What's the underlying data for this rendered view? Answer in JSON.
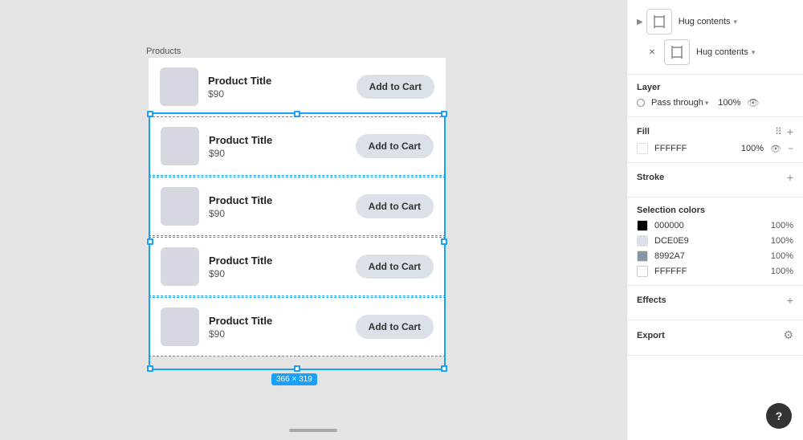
{
  "canvas": {
    "frame_label": "Products",
    "size_label": "366 × 319",
    "product_rows": [
      {
        "id": 1,
        "title": "Product Title",
        "price": "$90",
        "btn_label": "Add to Cart",
        "selected": false
      },
      {
        "id": 2,
        "title": "Product Title",
        "price": "$90",
        "btn_label": "Add to Cart",
        "selected": true
      },
      {
        "id": 3,
        "title": "Product Title",
        "price": "$90",
        "btn_label": "Add to Cart",
        "selected": true
      },
      {
        "id": 4,
        "title": "Product Title",
        "price": "$90",
        "btn_label": "Add to Cart",
        "selected": true
      },
      {
        "id": 5,
        "title": "Product Title",
        "price": "$90",
        "btn_label": "Add to Cart",
        "selected": true
      }
    ]
  },
  "panel": {
    "hug_top_label": "Hug contents",
    "hug_bottom_label": "Hug contents",
    "layer_section": {
      "title": "Layer",
      "mode": "Pass through",
      "opacity": "100%",
      "chevron": "▾"
    },
    "fill_section": {
      "title": "Fill",
      "color_hex": "FFFFFF",
      "opacity": "100%"
    },
    "stroke_section": {
      "title": "Stroke"
    },
    "selection_colors_section": {
      "title": "Selection colors",
      "colors": [
        {
          "hex": "000000",
          "opacity": "100%",
          "bg": "#000000"
        },
        {
          "hex": "DCE0E9",
          "opacity": "100%",
          "bg": "#DCE0E9"
        },
        {
          "hex": "8992A7",
          "opacity": "100%",
          "bg": "#8992A7"
        },
        {
          "hex": "FFFFFF",
          "opacity": "100%",
          "bg": "#FFFFFF"
        }
      ]
    },
    "effects_section": {
      "title": "Effects"
    },
    "export_section": {
      "title": "Export"
    }
  }
}
